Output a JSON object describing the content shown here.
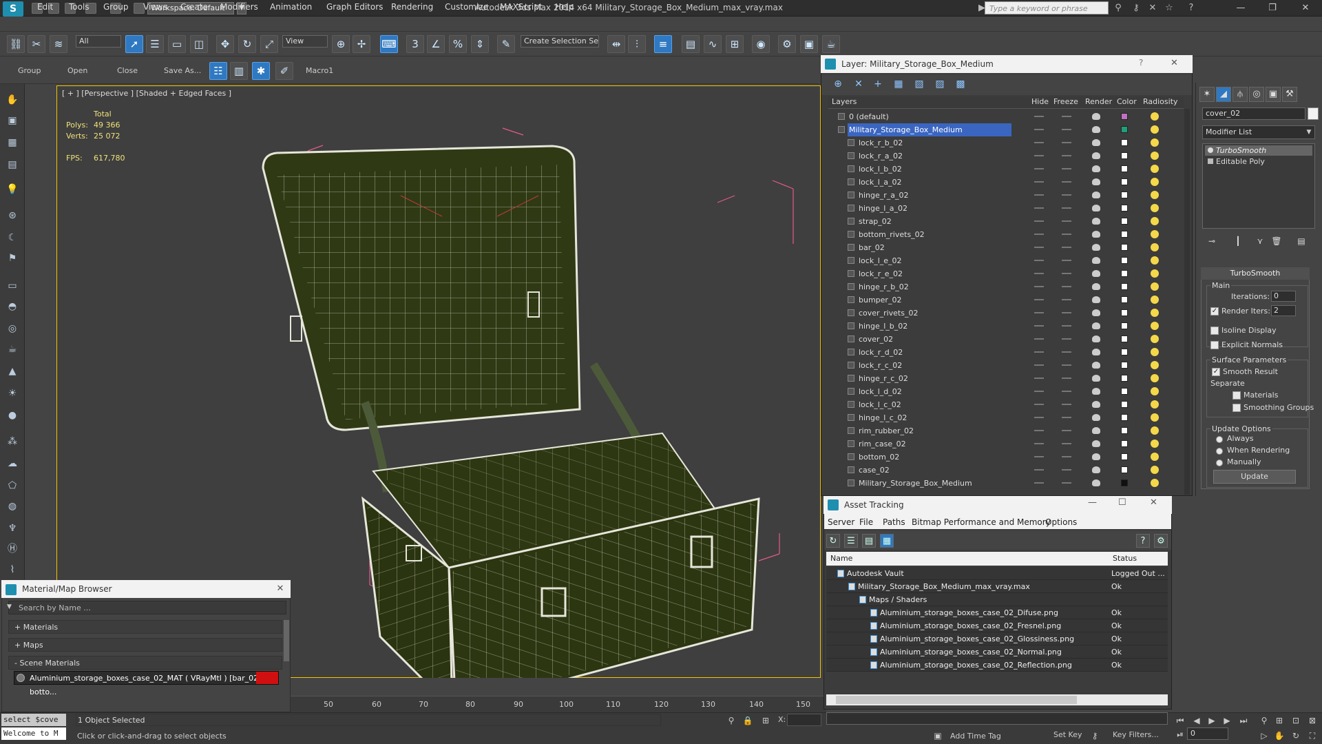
{
  "app": {
    "logo": "S",
    "window_title": "Autodesk 3ds Max 2014 x64     Military_Storage_Box_Medium_max_vray.max",
    "workspace": "Workspace: Default",
    "search_placeholder": "Type a keyword or phrase"
  },
  "menu": [
    "Edit",
    "Tools",
    "Group",
    "Views",
    "Create",
    "Modifiers",
    "Animation",
    "Graph Editors",
    "Rendering",
    "Customize",
    "MAXScript",
    "Help"
  ],
  "toolbar": {
    "selection_filter": "All",
    "ref_coord": "View",
    "named_selection": "Create Selection Se"
  },
  "ribbon": {
    "items": [
      "Group",
      "Open",
      "Close",
      "Save As...",
      "Macro1"
    ]
  },
  "viewport": {
    "label": "[ + ] [Perspective ] [Shaded + Edged Faces ]",
    "stats_header": "Total",
    "polys_label": "Polys:",
    "polys_value": "49 366",
    "verts_label": "Verts:",
    "verts_value": "25 072",
    "fps_label": "FPS:",
    "fps_value": "617,780"
  },
  "timeline": {
    "ticks": [
      "50",
      "60",
      "70",
      "80",
      "90",
      "100",
      "110",
      "120",
      "130",
      "140",
      "150"
    ]
  },
  "status": {
    "maxscript_1": "select $cove",
    "maxscript_2": "Welcome to M",
    "selected": "1 Object Selected",
    "prompt": "Click or click-and-drag to select objects",
    "x_label": "X:",
    "add_time_tag": "Add Time Tag",
    "set_key": "Set Key",
    "key_filters": "Key Filters...",
    "frame": "0"
  },
  "material_browser": {
    "title": "Material/Map Browser",
    "search": "Search by Name ...",
    "groups": [
      "+ Materials",
      "+ Maps",
      "- Scene Materials"
    ],
    "item": "Aluminium_storage_boxes_case_02_MAT ( VRayMtl ) [bar_02, botto..."
  },
  "layer_explorer": {
    "title": "Layer: Military_Storage_Box_Medium",
    "help": "?",
    "close": "✕",
    "columns": [
      "Layers",
      "Hide",
      "Freeze",
      "Render",
      "Color",
      "Radiosity"
    ],
    "rows": [
      {
        "name": "0 (default)",
        "color": "#c070c0",
        "level": 0
      },
      {
        "name": "Military_Storage_Box_Medium",
        "color": "#1fa07a",
        "level": 0
      },
      {
        "name": "lock_r_b_02",
        "color": "#ffffff",
        "level": 1
      },
      {
        "name": "lock_r_a_02",
        "color": "#ffffff",
        "level": 1
      },
      {
        "name": "lock_l_b_02",
        "color": "#ffffff",
        "level": 1
      },
      {
        "name": "lock_l_a_02",
        "color": "#ffffff",
        "level": 1
      },
      {
        "name": "hinge_r_a_02",
        "color": "#ffffff",
        "level": 1
      },
      {
        "name": "hinge_l_a_02",
        "color": "#ffffff",
        "level": 1
      },
      {
        "name": "strap_02",
        "color": "#ffffff",
        "level": 1
      },
      {
        "name": "bottom_rivets_02",
        "color": "#ffffff",
        "level": 1
      },
      {
        "name": "bar_02",
        "color": "#ffffff",
        "level": 1
      },
      {
        "name": "lock_l_e_02",
        "color": "#ffffff",
        "level": 1
      },
      {
        "name": "lock_r_e_02",
        "color": "#ffffff",
        "level": 1
      },
      {
        "name": "hinge_r_b_02",
        "color": "#ffffff",
        "level": 1
      },
      {
        "name": "bumper_02",
        "color": "#ffffff",
        "level": 1
      },
      {
        "name": "cover_rivets_02",
        "color": "#ffffff",
        "level": 1
      },
      {
        "name": "hinge_l_b_02",
        "color": "#ffffff",
        "level": 1
      },
      {
        "name": "cover_02",
        "color": "#ffffff",
        "level": 1
      },
      {
        "name": "lock_r_d_02",
        "color": "#ffffff",
        "level": 1
      },
      {
        "name": "lock_r_c_02",
        "color": "#ffffff",
        "level": 1
      },
      {
        "name": "hinge_r_c_02",
        "color": "#ffffff",
        "level": 1
      },
      {
        "name": "lock_l_d_02",
        "color": "#ffffff",
        "level": 1
      },
      {
        "name": "lock_l_c_02",
        "color": "#ffffff",
        "level": 1
      },
      {
        "name": "hinge_l_c_02",
        "color": "#ffffff",
        "level": 1
      },
      {
        "name": "rim_rubber_02",
        "color": "#ffffff",
        "level": 1
      },
      {
        "name": "rim_case_02",
        "color": "#ffffff",
        "level": 1
      },
      {
        "name": "bottom_02",
        "color": "#ffffff",
        "level": 1
      },
      {
        "name": "case_02",
        "color": "#ffffff",
        "level": 1
      },
      {
        "name": "Military_Storage_Box_Medium",
        "color": "#111111",
        "level": 1
      }
    ]
  },
  "command_panel": {
    "object_name": "cover_02",
    "modifier_list": "Modifier List",
    "stack": [
      "TurboSmooth",
      "Editable Poly"
    ],
    "rollout_title": "TurboSmooth",
    "main_label": "Main",
    "iterations_label": "Iterations:",
    "iterations": "0",
    "render_iters_label": "Render Iters:",
    "render_iters": "2",
    "isoline": "Isoline Display",
    "explicit_normals": "Explicit Normals",
    "surface_params": "Surface Parameters",
    "smooth_result": "Smooth Result",
    "separate": "Separate",
    "materials": "Materials",
    "smoothing_groups": "Smoothing Groups",
    "update_options": "Update Options",
    "always": "Always",
    "when_rendering": "When Rendering",
    "manually": "Manually",
    "update": "Update"
  },
  "asset_tracking": {
    "title": "Asset Tracking",
    "menu": [
      "Server",
      "File",
      "Paths",
      "Bitmap Performance and Memory",
      "Options"
    ],
    "columns": [
      "Name",
      "Status"
    ],
    "rows": [
      {
        "name": "Autodesk Vault",
        "status": "Logged Out ...",
        "level": 0
      },
      {
        "name": "Military_Storage_Box_Medium_max_vray.max",
        "status": "Ok",
        "level": 1
      },
      {
        "name": "Maps / Shaders",
        "status": "",
        "level": 2
      },
      {
        "name": "Aluminium_storage_boxes_case_02_Difuse.png",
        "status": "Ok",
        "level": 3
      },
      {
        "name": "Aluminium_storage_boxes_case_02_Fresnel.png",
        "status": "Ok",
        "level": 3
      },
      {
        "name": "Aluminium_storage_boxes_case_02_Glossiness.png",
        "status": "Ok",
        "level": 3
      },
      {
        "name": "Aluminium_storage_boxes_case_02_Normal.png",
        "status": "Ok",
        "level": 3
      },
      {
        "name": "Aluminium_storage_boxes_case_02_Reflection.png",
        "status": "Ok",
        "level": 3
      }
    ]
  }
}
